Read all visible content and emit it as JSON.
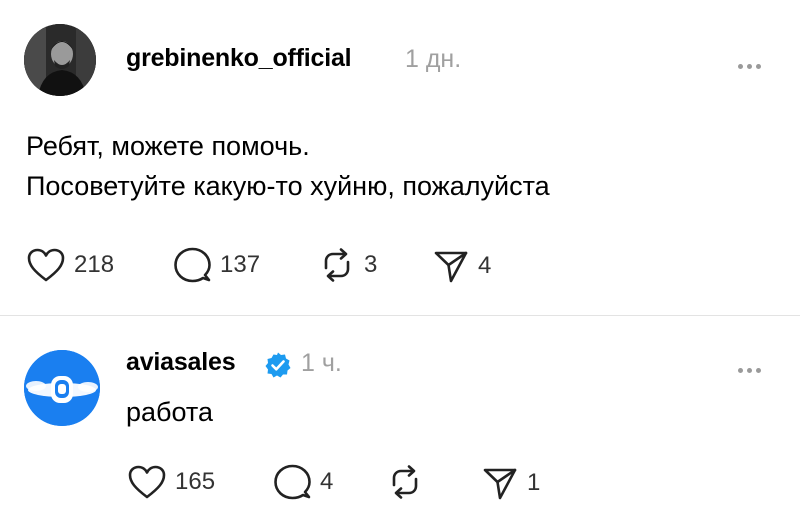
{
  "posts": [
    {
      "username": "grebinenko_official",
      "time": "1 дн.",
      "verified": false,
      "lines": [
        "Ребят, можете помочь.",
        "Посоветуйте какую-то хуйню, пожалуйста"
      ],
      "likes": "218",
      "comments": "137",
      "reposts": "3",
      "shares": "4"
    },
    {
      "username": "aviasales",
      "time": "1 ч.",
      "verified": true,
      "lines": [
        "работа"
      ],
      "likes": "165",
      "comments": "4",
      "reposts": "",
      "shares": "1"
    }
  ],
  "icons": {
    "like": "heart-icon",
    "comment": "comment-bubble-icon",
    "repost": "repost-icon",
    "share": "send-icon",
    "more": "more-dots-icon",
    "verified": "verified-badge-icon"
  },
  "colors": {
    "verified": "#1d9bf0",
    "aviasales_brand": "#1a7ff0",
    "timestamp": "#a0a0a0"
  }
}
